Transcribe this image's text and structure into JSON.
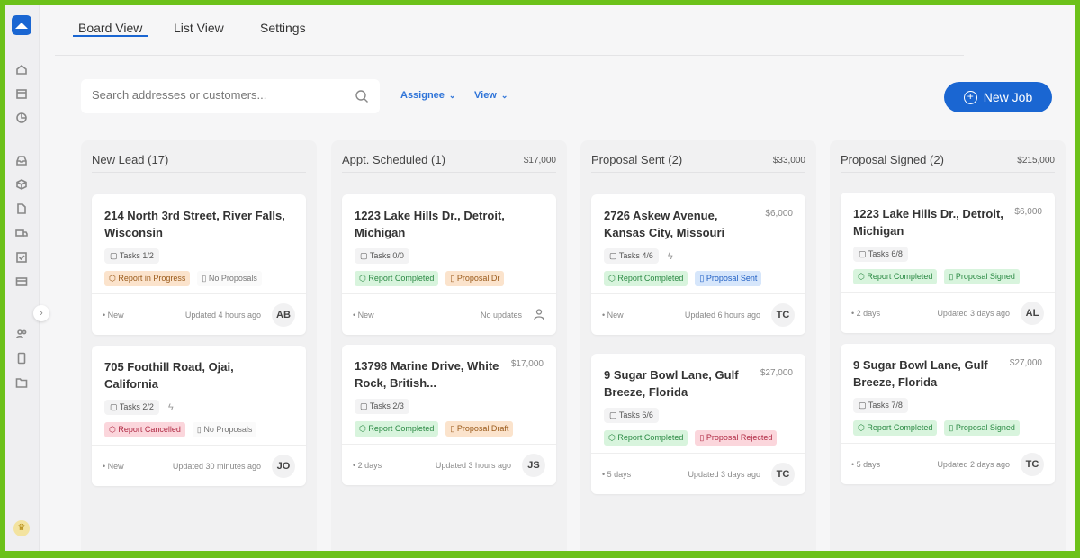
{
  "nav": {
    "tabs": [
      {
        "label": "Board View",
        "active": true
      },
      {
        "label": "List View"
      },
      {
        "label": "Settings"
      }
    ]
  },
  "sidebar": {
    "icons": [
      "home-icon",
      "calendar-icon",
      "chart-pie-icon",
      "inbox-icon",
      "box-icon",
      "document-icon",
      "truck-icon",
      "checkbox-icon",
      "credit-card-icon",
      "users-icon",
      "tablet-icon",
      "folder-icon"
    ]
  },
  "toolbar": {
    "search_placeholder": "Search addresses or customers...",
    "assignee": "Assignee",
    "view": "View",
    "new_job": "New Job"
  },
  "columns": [
    {
      "title": "New Lead (17)",
      "total": "",
      "cards": [
        {
          "address": "214 North 3rd Street, River Falls, Wisconsin",
          "price": "",
          "tasks": "Tasks 1/2",
          "bolt": false,
          "badges": [
            {
              "text": "Report in Progress",
              "color": "orange"
            },
            {
              "text": "No Proposals",
              "color": "gray"
            }
          ],
          "age": "• New",
          "updated": "Updated 4 hours ago",
          "avatar": "AB"
        },
        {
          "address": "705 Foothill Road, Ojai, California",
          "price": "",
          "tasks": "Tasks 2/2",
          "bolt": true,
          "badges": [
            {
              "text": "Report Cancelled",
              "color": "red"
            },
            {
              "text": "No Proposals",
              "color": "gray"
            }
          ],
          "age": "• New",
          "updated": "Updated 30 minutes ago",
          "avatar": "JO"
        }
      ]
    },
    {
      "title": "Appt. Scheduled (1)",
      "total": "$17,000",
      "cards": [
        {
          "address": "1223 Lake Hills Dr., Detroit, Michigan",
          "price": "",
          "tasks": "Tasks 0/0",
          "bolt": false,
          "badges": [
            {
              "text": "Report Completed",
              "color": "green"
            },
            {
              "text": "Proposal Dr",
              "color": "orange"
            }
          ],
          "age": "• New",
          "updated": "No updates",
          "avatar": ""
        },
        {
          "address": "13798 Marine Drive, White Rock, British...",
          "price": "$17,000",
          "tasks": "Tasks 2/3",
          "bolt": false,
          "badges": [
            {
              "text": "Report Completed",
              "color": "green"
            },
            {
              "text": "Proposal Draft",
              "color": "orange"
            }
          ],
          "age": "• 2 days",
          "updated": "Updated 3 hours ago",
          "avatar": "JS"
        }
      ]
    },
    {
      "title": "Proposal Sent (2)",
      "total": "$33,000",
      "cards": [
        {
          "address": "2726 Askew Avenue, Kansas City, Missouri",
          "price": "$6,000",
          "tasks": "Tasks 4/6",
          "bolt": true,
          "badges": [
            {
              "text": "Report Completed",
              "color": "green"
            },
            {
              "text": "Proposal Sent",
              "color": "blue"
            }
          ],
          "age": "• New",
          "updated": "Updated 6 hours ago",
          "avatar": "TC"
        },
        {
          "address": "9 Sugar Bowl Lane, Gulf Breeze, Florida",
          "price": "$27,000",
          "tasks": "Tasks 6/6",
          "bolt": false,
          "badges": [
            {
              "text": "Report Completed",
              "color": "green"
            },
            {
              "text": "Proposal Rejected",
              "color": "red"
            }
          ],
          "age": "• 5 days",
          "updated": "Updated 3 days ago",
          "avatar": "TC"
        }
      ]
    },
    {
      "title": "Proposal Signed (2)",
      "total": "$215,000",
      "cards": [
        {
          "address": "1223 Lake Hills Dr., Detroit, Michigan",
          "price": "$6,000",
          "tasks": "Tasks 6/8",
          "bolt": false,
          "badges": [
            {
              "text": "Report Completed",
              "color": "green"
            },
            {
              "text": "Proposal Signed",
              "color": "green"
            }
          ],
          "age": "• 2 days",
          "updated": "Updated 3 days ago",
          "avatar": "AL"
        },
        {
          "address": "9 Sugar Bowl Lane, Gulf Breeze, Florida",
          "price": "$27,000",
          "tasks": "Tasks 7/8",
          "bolt": false,
          "badges": [
            {
              "text": "Report Completed",
              "color": "green"
            },
            {
              "text": "Proposal Signed",
              "color": "green"
            }
          ],
          "age": "• 5 days",
          "updated": "Updated 2 days ago",
          "avatar": "TC"
        }
      ]
    }
  ]
}
